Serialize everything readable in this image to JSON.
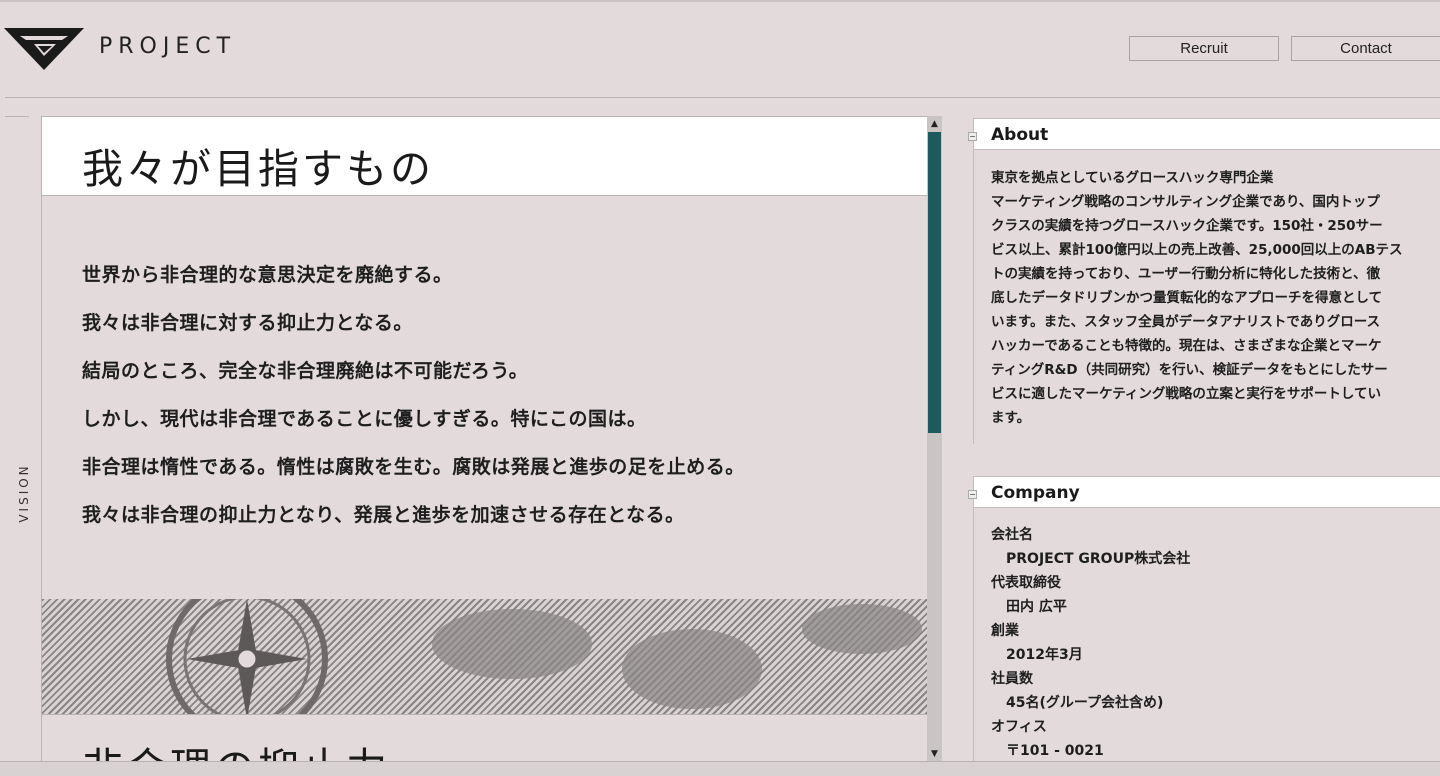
{
  "header": {
    "logo_text": "PROJECT",
    "nav": {
      "recruit": "Recruit",
      "contact": "Contact"
    }
  },
  "side_tab": {
    "label": "VISION"
  },
  "main": {
    "title": "我々が目指すもの",
    "vision_lines": [
      "世界から非合理的な意思決定を廃絶する。",
      "我々は非合理に対する抑止力となる。",
      "結局のところ、完全な非合理廃絶は不可能だろう。",
      "しかし、現代は非合理であることに優しすぎる。特にこの国は。",
      "非合理は惰性である。惰性は腐敗を生む。腐敗は発展と進歩の足を止める。",
      "我々は非合理の抑止力となり、発展と進歩を加速させる存在となる。"
    ],
    "title2": "非合理の抑止力"
  },
  "about": {
    "title": "About",
    "lines": [
      "東京を拠点としているグロースハック専門企業",
      "マーケティング戦略のコンサルティング企業であり、国内トップ",
      "クラスの実績を持つグロースハック企業です。150社・250サー",
      "ビス以上、累計100億円以上の売上改善、25,000回以上のABテス",
      "トの実績を持っており、ユーザー行動分析に特化した技術と、徹",
      "底したデータドリブンかつ量質転化的なアプローチを得意として",
      "います。また、スタッフ全員がデータアナリストでありグロース",
      "ハッカーであることも特徴的。現在は、さまざまな企業とマーケ",
      "ティングR&D（共同研究）を行い、検証データをもとにしたサー",
      "ビスに適したマーケティング戦略の立案と実行をサポートしてい",
      "ます。"
    ]
  },
  "company": {
    "title": "Company",
    "items": [
      {
        "label": "会社名",
        "value": "PROJECT GROUP株式会社"
      },
      {
        "label": "代表取締役",
        "value": "田内 広平"
      },
      {
        "label": "創業",
        "value": "2012年3月"
      },
      {
        "label": "社員数",
        "value": "45名(グループ会社含め)"
      },
      {
        "label": "オフィス",
        "value": "〒101 - 0021"
      }
    ]
  },
  "colors": {
    "background": "#e2dadb",
    "scroll_thumb": "#1e5a5c",
    "panel": "#ffffff"
  },
  "icons": {
    "logo": "logo-mark-icon",
    "scroll_up": "arrow-up-icon",
    "scroll_down": "arrow-down-icon",
    "collapse": "collapse-icon"
  }
}
